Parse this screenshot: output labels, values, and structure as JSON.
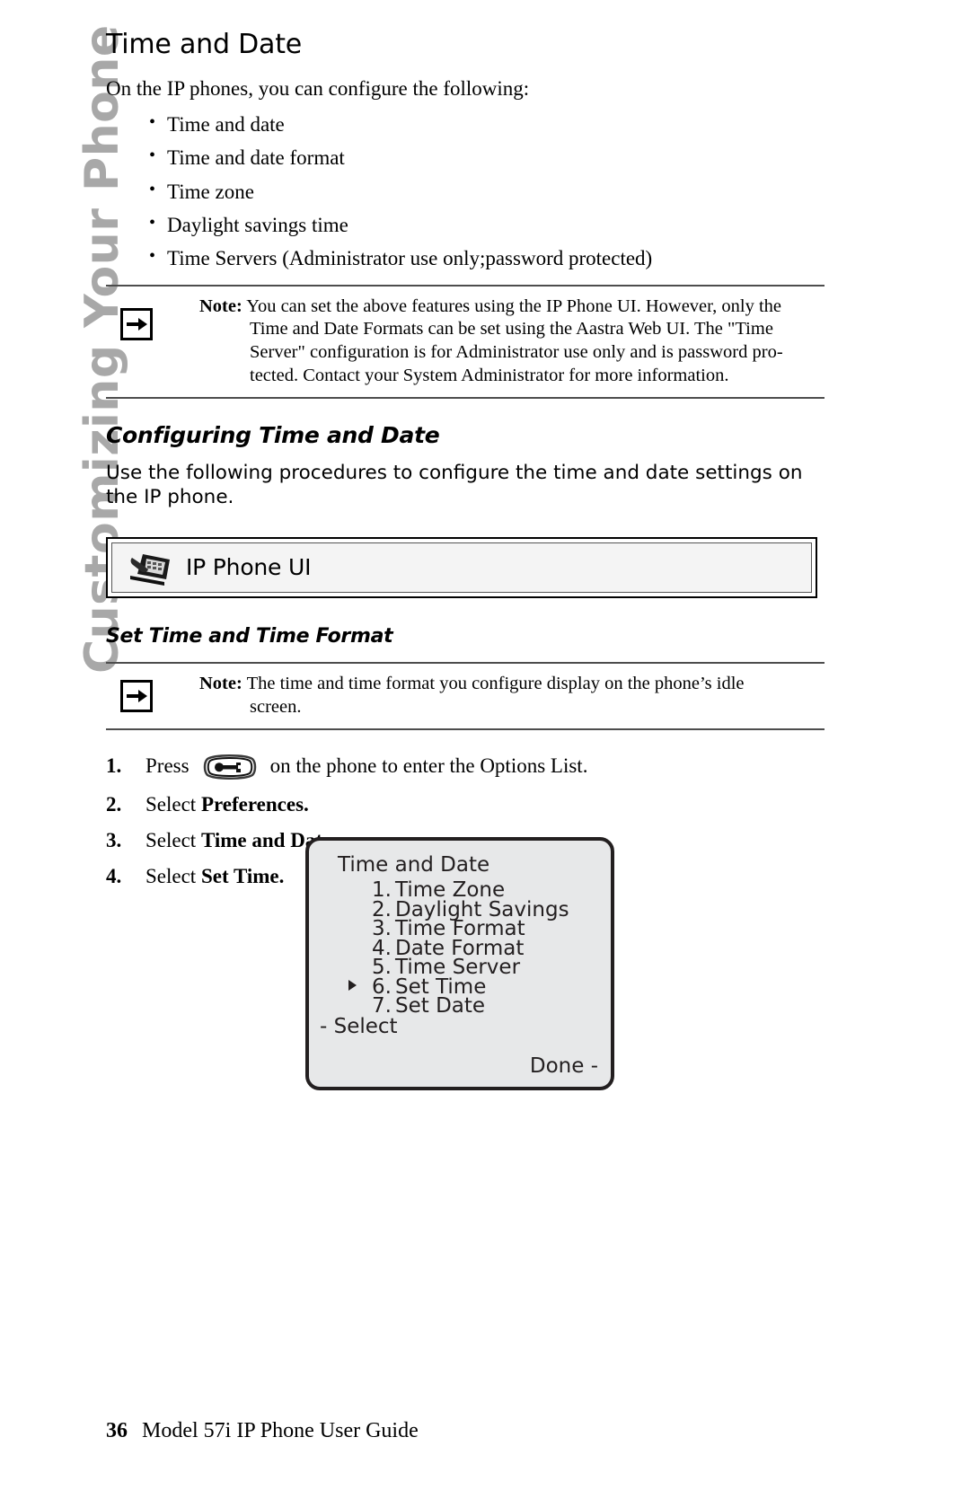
{
  "sidebar": {
    "chapter_label": "Customizing Your Phone"
  },
  "page": {
    "title": "Time and Date",
    "intro": "On the IP phones, you can configure the following:",
    "bullets": [
      "Time and date",
      "Time and date format",
      "Time zone",
      "Daylight savings time",
      "Time Servers (Administrator use only;password protected)"
    ],
    "note1": {
      "label": "Note:",
      "icon": "arrow-right-icon",
      "line1": "You can set the above features using the IP Phone UI. However, only the",
      "line2": "Time and Date Formats can be set using the Aastra Web UI. The \"Time",
      "line3": "Server\" configuration is for Administrator use only and is password pro-",
      "line4": "tected. Contact your System Administrator for more information."
    },
    "section_heading": "Configuring Time and Date",
    "section_body": "Use the following procedures to configure the time and date settings on the IP phone.",
    "ui_banner": {
      "icon": "desk-phone-icon",
      "label": "IP Phone UI"
    },
    "subsection_heading": "Set Time and Time Format",
    "note2": {
      "label": "Note:",
      "icon": "arrow-right-icon",
      "line1": "The time and time format you configure display on the phone’s idle",
      "line2": "screen."
    },
    "steps": [
      {
        "num": "1.",
        "text_before": "Press",
        "icon": "options-key-icon",
        "text_after": "on the phone to enter the Options List."
      },
      {
        "num": "2.",
        "text_before": "Select ",
        "bold": "Preferences."
      },
      {
        "num": "3.",
        "text_before": "Select ",
        "bold": "Time and Date."
      },
      {
        "num": "4.",
        "text_before": "Select ",
        "bold": "Set Time."
      }
    ],
    "phone_screen": {
      "title": "Time and Date",
      "menu": [
        {
          "index": "1.",
          "label": "Time Zone",
          "selected": false
        },
        {
          "index": "2.",
          "label": "Daylight Savings",
          "selected": false
        },
        {
          "index": "3.",
          "label": "Time Format",
          "selected": false
        },
        {
          "index": "4.",
          "label": "Date Format",
          "selected": false
        },
        {
          "index": "5.",
          "label": "Time Server",
          "selected": false
        },
        {
          "index": "6.",
          "label": "Set Time",
          "selected": true
        },
        {
          "index": "7.",
          "label": "Set Date",
          "selected": false
        }
      ],
      "softkey_left": "- Select",
      "softkey_right": "Done -"
    },
    "footer": {
      "page_number": "36",
      "guide_title": "Model 57i IP Phone User Guide"
    }
  },
  "colors": {
    "sidebar_text": "#a8a8a8",
    "screen_bg": "#e7e8e9",
    "screen_border": "#231f20",
    "banner_bg": "#f4f4f4",
    "rule": "#4d4d4d"
  }
}
